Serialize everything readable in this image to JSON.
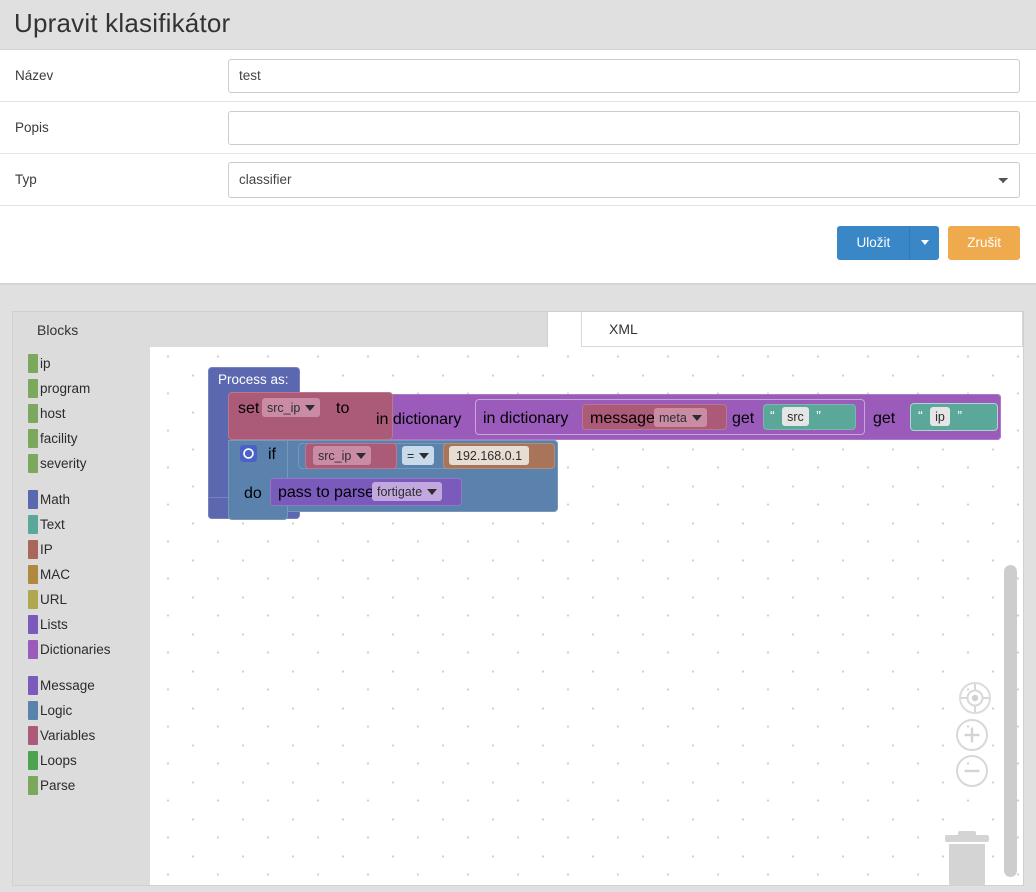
{
  "page": {
    "title": "Upravit klasifikátor"
  },
  "form": {
    "rows": [
      {
        "label": "Název",
        "type": "text",
        "value": "test",
        "placeholder": ""
      },
      {
        "label": "Popis",
        "type": "text",
        "value": "",
        "placeholder": ""
      },
      {
        "label": "Typ",
        "type": "select",
        "value": "classifier",
        "options": [
          "classifier"
        ]
      }
    ]
  },
  "actions": {
    "save_label": "Uložit",
    "save_dropdown_icon": "caret-down-icon",
    "cancel_label": "Zrušit",
    "save_color": "#3a87c8",
    "cancel_color": "#eeaa4d"
  },
  "editor": {
    "tabs": [
      {
        "label": "Blocks",
        "active": true
      },
      {
        "label": "XML",
        "active": false
      }
    ],
    "toolbox": [
      {
        "label": "ip",
        "color": "#7ba85c"
      },
      {
        "label": "program",
        "color": "#7ba85c"
      },
      {
        "label": "host",
        "color": "#7ba85c"
      },
      {
        "label": "facility",
        "color": "#7ba85c"
      },
      {
        "label": "severity",
        "color": "#7ba85c"
      },
      {
        "separator": true
      },
      {
        "label": "Math",
        "color": "#5b67ae"
      },
      {
        "label": "Text",
        "color": "#5ba89a"
      },
      {
        "label": "IP",
        "color": "#a9665a"
      },
      {
        "label": "MAC",
        "color": "#b0883f"
      },
      {
        "label": "URL",
        "color": "#b0a84f"
      },
      {
        "label": "Lists",
        "color": "#7a5bbb"
      },
      {
        "label": "Dictionaries",
        "color": "#9a5bbb"
      },
      {
        "separator": true
      },
      {
        "label": "Message",
        "color": "#7a5bbb"
      },
      {
        "label": "Logic",
        "color": "#5b82ad"
      },
      {
        "label": "Variables",
        "color": "#ab5b77"
      },
      {
        "label": "Loops",
        "color": "#4da350"
      },
      {
        "label": "Parse",
        "color": "#7ba85c"
      }
    ],
    "blocks": {
      "process_as_label": "Process as:",
      "set_label": "set",
      "set_variable": "src_ip",
      "to_label": "to",
      "dict_outer_label": "in dictionary",
      "dict_inner_label": "in dictionary",
      "message_label": "message",
      "message_field": "meta",
      "get_label_1": "get",
      "get_text_1": "src",
      "get_label_2": "get",
      "get_text_2": "ip",
      "quote_open": "“",
      "quote_close": "”",
      "if_label": "if",
      "if_gear_icon": "gear-icon",
      "if_variable": "src_ip",
      "compare_operator": "=",
      "compare_value": "192.168.0.1",
      "do_label": "do",
      "parser_label": "pass to parser",
      "parser_value": "fortigate"
    },
    "controls": {
      "center_icon": "target-center-icon",
      "zoom_in_icon": "zoom-in-icon",
      "zoom_out_icon": "zoom-out-icon",
      "trash_icon": "trash-icon"
    }
  }
}
